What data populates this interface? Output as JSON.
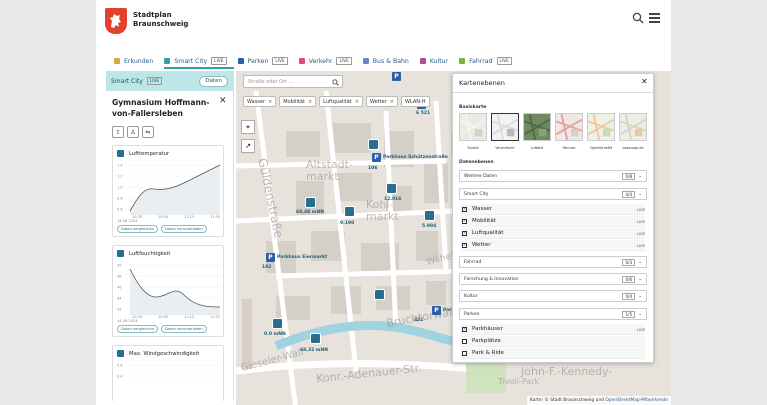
{
  "header": {
    "brand_line1": "Stadtplan",
    "brand_line2": "Braunschweig"
  },
  "tabs": [
    {
      "label": "Erkunden",
      "color": "#d4a84b",
      "live": ""
    },
    {
      "label": "Smart City",
      "color": "#2fa3a8",
      "live": "LIVE"
    },
    {
      "label": "Parken",
      "color": "#2d5ea8",
      "live": "LIVE"
    },
    {
      "label": "Verkehr",
      "color": "#e04f70",
      "live": "LIVE"
    },
    {
      "label": "Bus & Bahn",
      "color": "#6a86c9",
      "live": ""
    },
    {
      "label": "Kultur",
      "color": "#b84a9a",
      "live": ""
    },
    {
      "label": "Fahrrad",
      "color": "#7bb43c",
      "live": "LIVE"
    }
  ],
  "panel": {
    "header_label": "Smart City",
    "header_live": "LIVE",
    "data_button": "Daten",
    "poi_title": "Gymnasium Hoffmann-von-Fallersleben",
    "cards": [
      {
        "title": "Lufttemperatur",
        "date": "14.08.2024",
        "compare": "Daten vergleichen",
        "download": "Daten herunterladen",
        "yticks": [
          "1.4",
          "1.2",
          "1.0",
          "0.8",
          "0.6"
        ],
        "xticks": [
          "10:35",
          "10:55",
          "11:15",
          "11:35"
        ]
      },
      {
        "title": "Luftfeuchtigkeit",
        "date": "14.08.2024",
        "compare": "Daten vergleichen",
        "download": "Daten herunterladen",
        "yticks": [
          "50",
          "48",
          "46",
          "44",
          "42"
        ],
        "xticks": [
          "10:35",
          "10:55",
          "11:15",
          "11:35"
        ]
      },
      {
        "title": "Max. Windgeschwindigkeit",
        "date": "",
        "compare": "",
        "download": "",
        "yticks": [
          "0.6",
          "0.4"
        ],
        "xticks": []
      }
    ]
  },
  "map": {
    "search_placeholder": "Straße oder Ort ...",
    "filters": [
      "Wasser",
      "Mobilität",
      "Luftqualität",
      "Wetter",
      "WLAN-H"
    ],
    "streetnames": [
      "Güldenstraße",
      "Altstadt-markt",
      "Kohl-markt",
      "Bruchtorwall",
      "Konr.-Adenauer-Str.",
      "John-F.-Kennedy-",
      "Tivoli-Park",
      "Gieseler-Wall",
      "Wilhelm-Str."
    ],
    "parking_labels": [
      "Parkhaus Schützenstraße",
      "Parkhaus Eiermarkt",
      "Parkhaus Packhof"
    ],
    "parking_counts": [
      "106",
      "182",
      "421",
      "6 521"
    ],
    "sensor_labels": [
      "68,48 mNN",
      "12.016",
      "9.190",
      "5.994",
      "0.0 mNN",
      "68,32 mNN"
    ],
    "attribution": "Karte: © Stadt Braunschweig und",
    "attribution_link": "OpenStreetMap-Mitwirkende"
  },
  "layers": {
    "title": "Kartenebenen",
    "basemap_label": "Basiskarte",
    "basemaps": [
      {
        "label": "Straße",
        "selected": false
      },
      {
        "label": "Vereinfacht",
        "selected": true
      },
      {
        "label": "Luftbild",
        "selected": false
      },
      {
        "label": "Fahrrad",
        "selected": false
      },
      {
        "label": "OpenStreetM",
        "selected": false
      },
      {
        "label": "basemap.de",
        "selected": false
      }
    ],
    "data_label": "Datenebenen",
    "groups": [
      {
        "label": "Weitere Daten",
        "count": "0/8"
      },
      {
        "label": "Smart City",
        "count": "4/4"
      },
      {
        "label": "Fahrrad",
        "count": "0/3"
      },
      {
        "label": "Forschung & Innovation",
        "count": "0/6"
      },
      {
        "label": "Kultur",
        "count": "0/4"
      },
      {
        "label": "Parken",
        "count": "1/5"
      }
    ],
    "smart_city_items": [
      {
        "label": "Wasser",
        "live": "LIVE",
        "checked": true
      },
      {
        "label": "Mobilität",
        "live": "LIVE",
        "checked": true
      },
      {
        "label": "Luftqualität",
        "live": "LIVE",
        "checked": true
      },
      {
        "label": "Wetter",
        "live": "LIVE",
        "checked": true
      }
    ],
    "parken_items": [
      {
        "label": "Parkhäuser",
        "live": "LIVE",
        "checked": true
      },
      {
        "label": "Parkplätze",
        "live": "",
        "checked": false
      },
      {
        "label": "Park & Ride",
        "live": "",
        "checked": false
      }
    ]
  },
  "colors": {
    "accent": "#2fa3a8",
    "brand_red": "#e2412e",
    "pin": "#2a6e8f"
  }
}
